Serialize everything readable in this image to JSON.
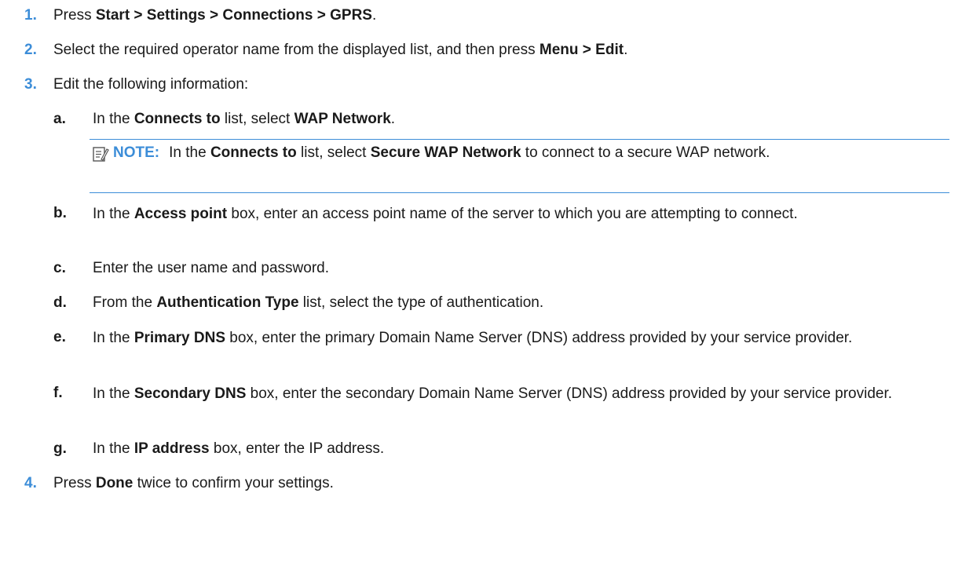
{
  "steps": [
    {
      "num": "1.",
      "parts": [
        {
          "t": "Press ",
          "b": false
        },
        {
          "t": "Start > Settings > Connections > GPRS",
          "b": true
        },
        {
          "t": ".",
          "b": false
        }
      ]
    },
    {
      "num": "2.",
      "parts": [
        {
          "t": "Select the required operator name from the displayed list, and then press ",
          "b": false
        },
        {
          "t": "Menu > Edit",
          "b": true
        },
        {
          "t": ".",
          "b": false
        }
      ]
    },
    {
      "num": "3.",
      "parts": [
        {
          "t": "Edit the following information:",
          "b": false
        }
      ]
    },
    {
      "num": "4.",
      "parts": [
        {
          "t": "Press ",
          "b": false
        },
        {
          "t": "Done",
          "b": true
        },
        {
          "t": " twice to confirm your settings.",
          "b": false
        }
      ]
    }
  ],
  "substeps": [
    {
      "letter": "a.",
      "parts": [
        {
          "t": "In the ",
          "b": false
        },
        {
          "t": "Connects to",
          "b": true
        },
        {
          "t": " list, select ",
          "b": false
        },
        {
          "t": "WAP Network",
          "b": true
        },
        {
          "t": ".",
          "b": false
        }
      ]
    },
    {
      "letter": "b.",
      "parts": [
        {
          "t": "In the ",
          "b": false
        },
        {
          "t": "Access point",
          "b": true
        },
        {
          "t": " box, enter an access point name of the server to which you are attempting to connect.",
          "b": false
        }
      ]
    },
    {
      "letter": "c.",
      "parts": [
        {
          "t": "Enter the user name and password.",
          "b": false
        }
      ]
    },
    {
      "letter": "d.",
      "parts": [
        {
          "t": "From the ",
          "b": false
        },
        {
          "t": "Authentication Type",
          "b": true
        },
        {
          "t": " list, select the type of authentication.",
          "b": false
        }
      ]
    },
    {
      "letter": "e.",
      "parts": [
        {
          "t": "In the ",
          "b": false
        },
        {
          "t": "Primary DNS",
          "b": true
        },
        {
          "t": " box, enter the primary Domain Name Server (DNS) address provided by your service provider.",
          "b": false
        }
      ]
    },
    {
      "letter": "f.",
      "parts": [
        {
          "t": "In the ",
          "b": false
        },
        {
          "t": "Secondary DNS",
          "b": true
        },
        {
          "t": " box, enter the secondary Domain Name Server (DNS) address provided by your service provider.",
          "b": false
        }
      ]
    },
    {
      "letter": "g.",
      "parts": [
        {
          "t": "In the ",
          "b": false
        },
        {
          "t": "IP address",
          "b": true
        },
        {
          "t": " box, enter the IP address.",
          "b": false
        }
      ]
    }
  ],
  "note": {
    "icon": "note-pencil-icon",
    "label": "NOTE:",
    "parts": [
      {
        "t": "In the ",
        "b": false
      },
      {
        "t": "Connects to",
        "b": true
      },
      {
        "t": " list, select ",
        "b": false
      },
      {
        "t": "Secure WAP Network",
        "b": true
      },
      {
        "t": " to connect to a secure WAP network.",
        "b": false
      }
    ]
  },
  "colors": {
    "accent": "#3c8dd8",
    "text": "#1a1a1a"
  }
}
